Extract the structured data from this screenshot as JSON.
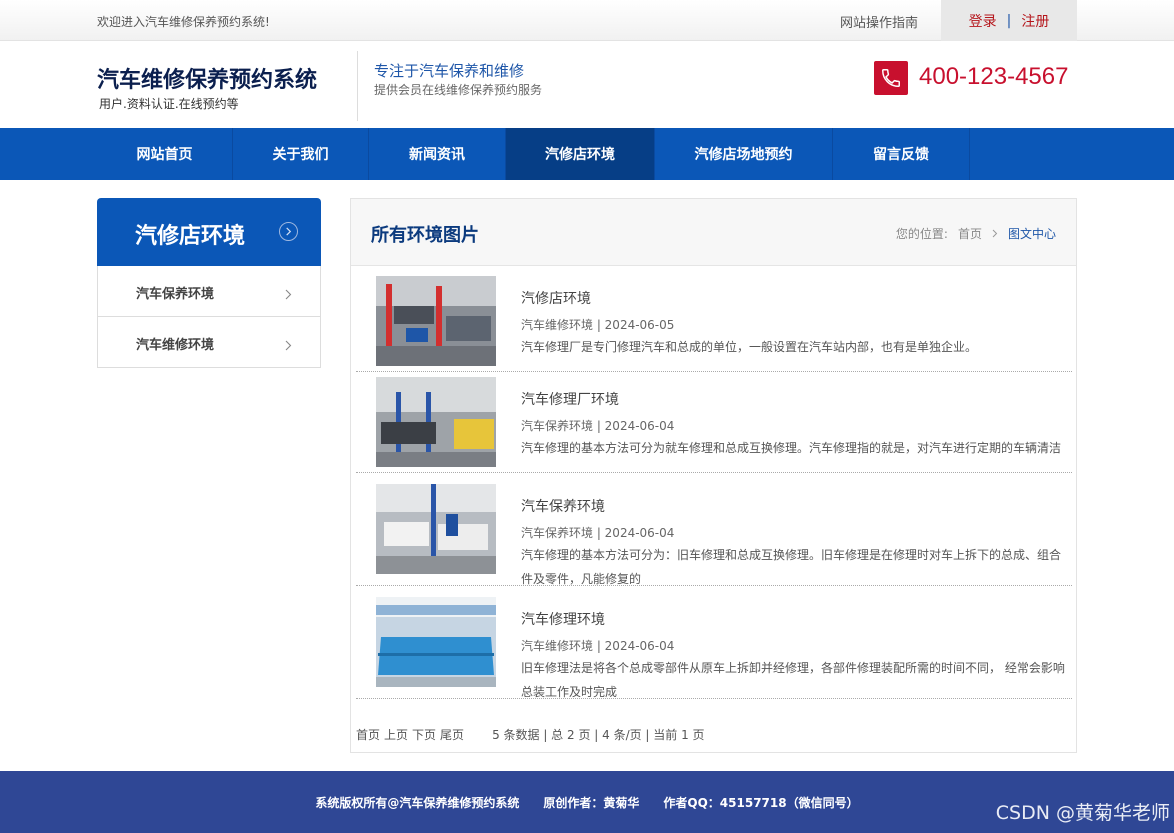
{
  "topbar": {
    "welcome": "欢迎进入汽车维修保养预约系统!",
    "guide": "网站操作指南",
    "login": "登录",
    "separator": "|",
    "register": "注册"
  },
  "header": {
    "title": "汽车维修保养预约系统",
    "subtitle": "用户.资料认证.在线预约等",
    "slogan": "专注于汽车保养和维修",
    "slogan_sub": "提供会员在线维修保养预约服务",
    "phone": "400-123-4567",
    "phone_icon": "phone-icon",
    "phone_color": "#c8102e"
  },
  "nav": {
    "items": [
      {
        "label": "网站首页"
      },
      {
        "label": "关于我们"
      },
      {
        "label": "新闻资讯"
      },
      {
        "label": "汽修店环境",
        "active": true
      },
      {
        "label": "汽修店场地预约"
      },
      {
        "label": "留言反馈"
      }
    ],
    "color": "#0b57b7"
  },
  "sidebar": {
    "title": "汽修店环境",
    "items": [
      {
        "label": "汽车保养环境"
      },
      {
        "label": "汽车维修环境"
      }
    ]
  },
  "main": {
    "title": "所有环境图片",
    "breadcrumb": {
      "prefix": "您的位置:",
      "home": "首页",
      "current": "图文中心"
    },
    "entries": [
      {
        "title": "汽修店环境",
        "meta": "汽车维修环境 | 2024-06-05",
        "desc": "汽车修理厂是专门修理汽车和总成的单位，一般设置在汽车站内部，也有是单独企业。"
      },
      {
        "title": "汽车修理厂环境",
        "meta": "汽车保养环境 | 2024-06-04",
        "desc": "汽车修理的基本方法可分为就车修理和总成互换修理。汽车修理指的就是，对汽车进行定期的车辆清洁"
      },
      {
        "title": "汽车保养环境",
        "meta": "汽车保养环境 | 2024-06-04",
        "desc": "汽车修理的基本方法可分为：旧车修理和总成互换修理。旧车修理是在修理时对车上拆下的总成、组合件及零件，凡能修复的"
      },
      {
        "title": "汽车修理环境",
        "meta": "汽车维修环境 | 2024-06-04",
        "desc": "旧车修理法是将各个总成零部件从原车上拆卸并经修理，各部件修理装配所需的时间不同， 经常会影响总装工作及时完成"
      }
    ],
    "pager": {
      "first": "首页",
      "prev": "上页",
      "next": "下页",
      "last": "尾页",
      "info": "5 条数据 | 总 2 页 | 4 条/页 | 当前 1 页"
    }
  },
  "footer": {
    "text": "系统版权所有@汽车保养维修预约系统　　原创作者：黄菊华　　作者QQ：45157718（微信同号）",
    "watermark": "CSDN @黄菊华老师"
  }
}
